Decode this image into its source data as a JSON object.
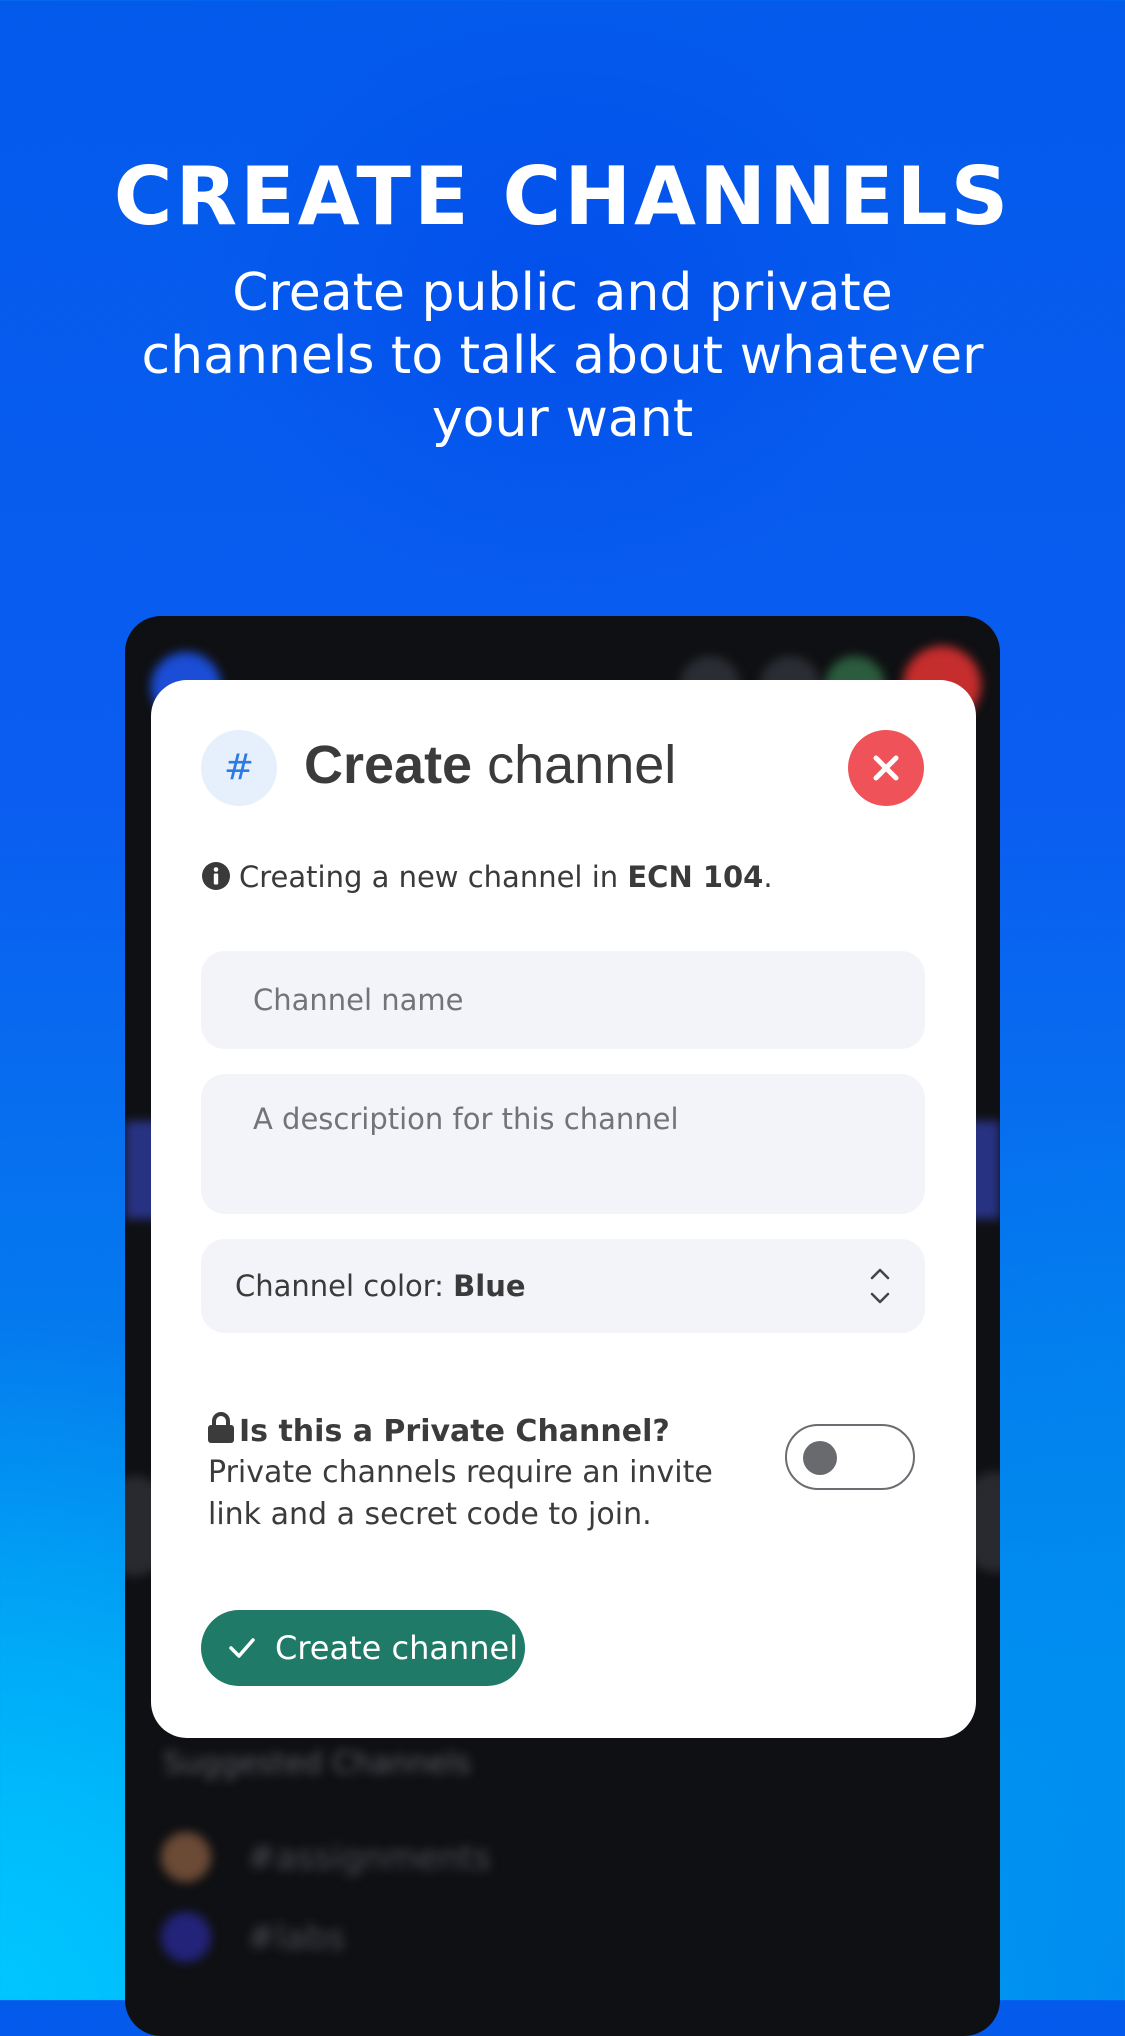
{
  "hero": {
    "title": "CREATE CHANNELS",
    "subtitle": "Create public and private channels to talk about whatever your want"
  },
  "background_app": {
    "suggested_title": "Suggested Channels",
    "suggested_items": [
      {
        "label": "#assignments",
        "color": "#c4763a"
      },
      {
        "label": "#labs",
        "color": "#2d2fb0"
      }
    ]
  },
  "modal": {
    "icon": "hash-icon",
    "title_bold": "Create",
    "title_rest": " channel",
    "info_prefix": "Creating a new channel in ",
    "info_course": "ECN 104",
    "info_suffix": ".",
    "channel_name_placeholder": "Channel name",
    "description_placeholder": "A description for this channel",
    "color_label": "Channel color: ",
    "color_value": "Blue",
    "private_title": "Is this a Private Channel?",
    "private_desc": "Private channels require an invite link and a secret code to join.",
    "private_enabled": false,
    "create_button": "Create channel"
  },
  "colors": {
    "close_button": "#f0525a",
    "create_button": "#1f7a68",
    "hash_badge_bg": "#e6effc",
    "hash_color": "#2d7be2",
    "field_bg": "#f3f4f9"
  }
}
